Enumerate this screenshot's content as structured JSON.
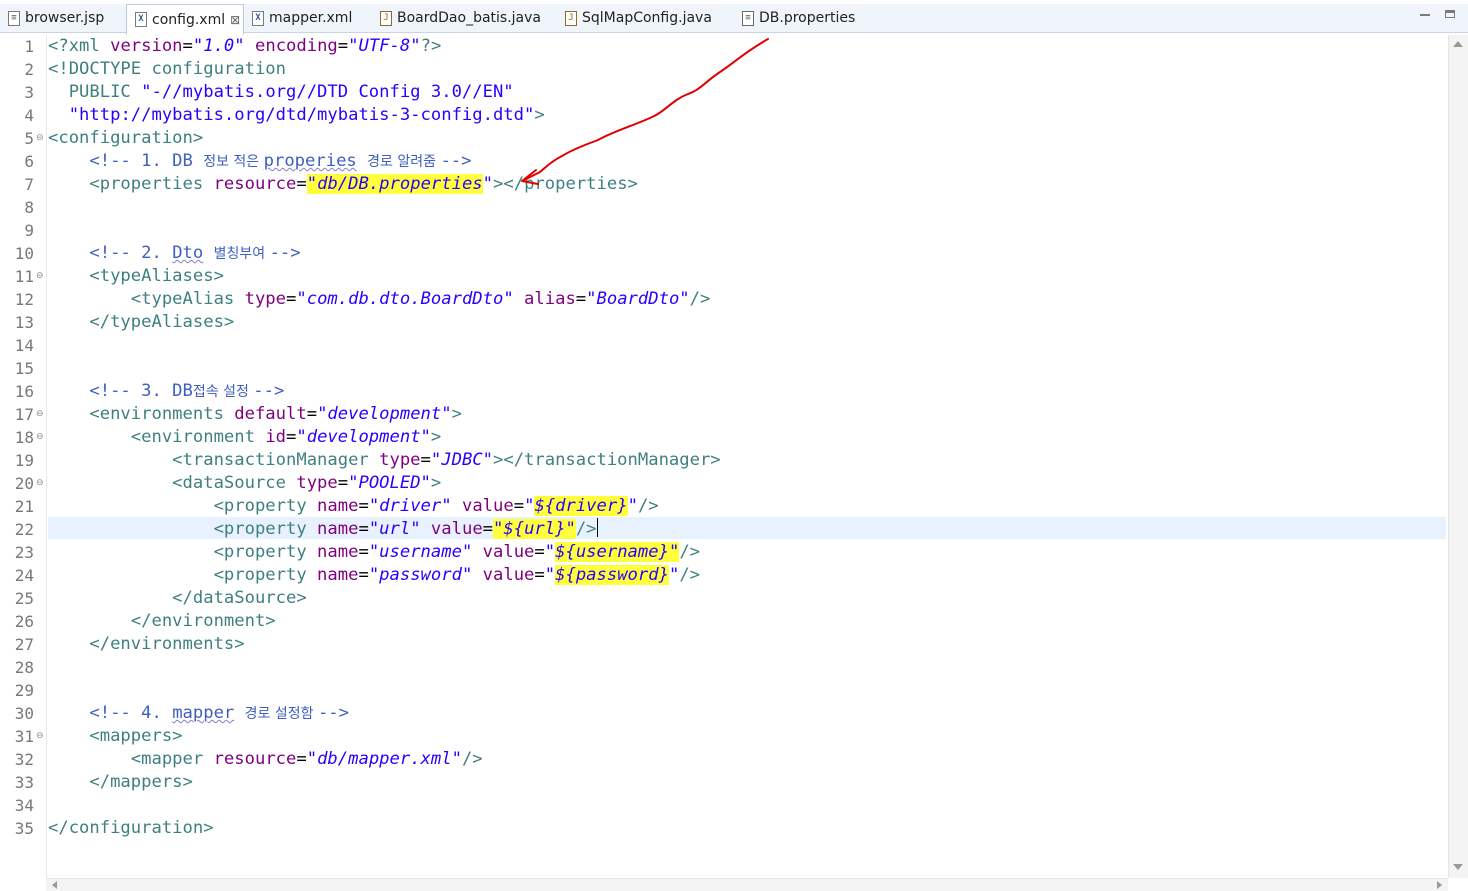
{
  "tabs": [
    {
      "label": "browser.jsp",
      "icon": "jsp-file-icon"
    },
    {
      "label": "config.xml",
      "icon": "xml-file-icon",
      "active": true,
      "close": "⊠"
    },
    {
      "label": "mapper.xml",
      "icon": "xml-file-icon"
    },
    {
      "label": "BoardDao_batis.java",
      "icon": "java-file-icon"
    },
    {
      "label": "SqlMapConfig.java",
      "icon": "java-file-icon"
    },
    {
      "label": "DB.properties",
      "icon": "properties-file-icon"
    }
  ],
  "editor": {
    "current_line": 22,
    "line_numbers": [
      "1",
      "2",
      "3",
      "4",
      "5",
      "6",
      "7",
      "8",
      "9",
      "10",
      "11",
      "12",
      "13",
      "14",
      "15",
      "16",
      "17",
      "18",
      "19",
      "20",
      "21",
      "22",
      "23",
      "24",
      "25",
      "26",
      "27",
      "28",
      "29",
      "30",
      "31",
      "32",
      "33",
      "34",
      "35"
    ],
    "folded_lines": [
      5,
      11,
      17,
      18,
      20,
      31
    ],
    "tokens": {
      "l1_a": "<?xml ",
      "l1_b": "version",
      "l1_c": "=",
      "l1_d": "\"1.0\"",
      "l1_e": " ",
      "l1_f": "encoding",
      "l1_g": "=",
      "l1_h": "\"UTF-8\"",
      "l1_i": "?>",
      "l2_a": "<!DOCTYPE configuration",
      "l3_a": "  PUBLIC ",
      "l3_b": "\"-//mybatis.org//DTD Config 3.0//EN\"",
      "l4_a": "  ",
      "l4_b": "\"http://mybatis.org/dtd/mybatis-3-config.dtd\"",
      "l4_c": ">",
      "l5_a": "<configuration>",
      "l6_a": "    <!-- 1. DB ",
      "l6_b": "정보 적은 ",
      "l6_c": "properies",
      "l6_d": " ",
      "l6_e": "경로 알려줌 ",
      "l6_f": "-->",
      "l7_a": "    <properties ",
      "l7_b": "resource",
      "l7_c": "=",
      "l7_d": "\"",
      "l7_e": "db/DB.properties",
      "l7_f": "\"",
      "l7_g": "></properties>",
      "l10_a": "    <!-- 2. ",
      "l10_b": "Dto",
      "l10_c": " ",
      "l10_d": "별칭부여 ",
      "l10_e": "-->",
      "l11_a": "    <typeAliases>",
      "l12_a": "        <typeAlias ",
      "l12_b": "type",
      "l12_c": "=",
      "l12_d": "\"com.db.dto.BoardDto\"",
      "l12_e": " ",
      "l12_f": "alias",
      "l12_g": "=",
      "l12_h": "\"BoardDto\"",
      "l12_i": "/>",
      "l13_a": "    </typeAliases>",
      "l16_a": "    <!-- 3. DB",
      "l16_b": "접속 설정 ",
      "l16_c": "-->",
      "l17_a": "    <environments ",
      "l17_b": "default",
      "l17_c": "=",
      "l17_d": "\"development\"",
      "l17_e": ">",
      "l18_a": "        <environment ",
      "l18_b": "id",
      "l18_c": "=",
      "l18_d": "\"development\"",
      "l18_e": ">",
      "l19_a": "            <transactionManager ",
      "l19_b": "type",
      "l19_c": "=",
      "l19_d": "\"JDBC\"",
      "l19_e": "></transactionManager>",
      "l20_a": "            <dataSource ",
      "l20_b": "type",
      "l20_c": "=",
      "l20_d": "\"POOLED\"",
      "l20_e": ">",
      "l21_a": "                <property ",
      "l21_b": "name",
      "l21_c": "=",
      "l21_d": "\"driver\"",
      "l21_e": " ",
      "l21_f": "value",
      "l21_g": "=",
      "l21_h": "\"",
      "l21_i": "${driver}",
      "l21_j": "\"",
      "l21_k": "/>",
      "l22_a": "                <property ",
      "l22_b": "name",
      "l22_c": "=",
      "l22_d": "\"url\"",
      "l22_e": " ",
      "l22_f": "value",
      "l22_g": "=",
      "l22_h": "\"${url}\"",
      "l22_i": "/>",
      "l23_a": "                <property ",
      "l23_b": "name",
      "l23_c": "=",
      "l23_d": "\"username\"",
      "l23_e": " ",
      "l23_f": "value",
      "l23_g": "=",
      "l23_h": "\"",
      "l23_i": "${username}\"",
      "l23_j": "/>",
      "l24_a": "                <property ",
      "l24_b": "name",
      "l24_c": "=",
      "l24_d": "\"password\"",
      "l24_e": " ",
      "l24_f": "value",
      "l24_g": "=",
      "l24_h": "\"",
      "l24_i": "${password}",
      "l24_j": "\"",
      "l24_k": "/>",
      "l25_a": "            </dataSource>",
      "l26_a": "        </environment>",
      "l27_a": "    </environments>",
      "l30_a": "    <!-- 4. ",
      "l30_b": "mapper",
      "l30_c": " ",
      "l30_d": "경로 설정함 ",
      "l30_e": "-->",
      "l31_a": "    <mappers>",
      "l32_a": "        <mapper ",
      "l32_b": "resource",
      "l32_c": "=",
      "l32_d": "\"db/mapper.xml\"",
      "l32_e": "/>",
      "l33_a": "    </mappers>",
      "l35_a": "</configuration>"
    }
  },
  "colors": {
    "tag": "#3f7f7f",
    "attribute": "#7f007f",
    "value": "#2a00ff",
    "comment": "#3f5fbf",
    "highlight": "#ffff3c",
    "annotation_arrow": "#e00000",
    "current_line": "#e8f2fe"
  }
}
